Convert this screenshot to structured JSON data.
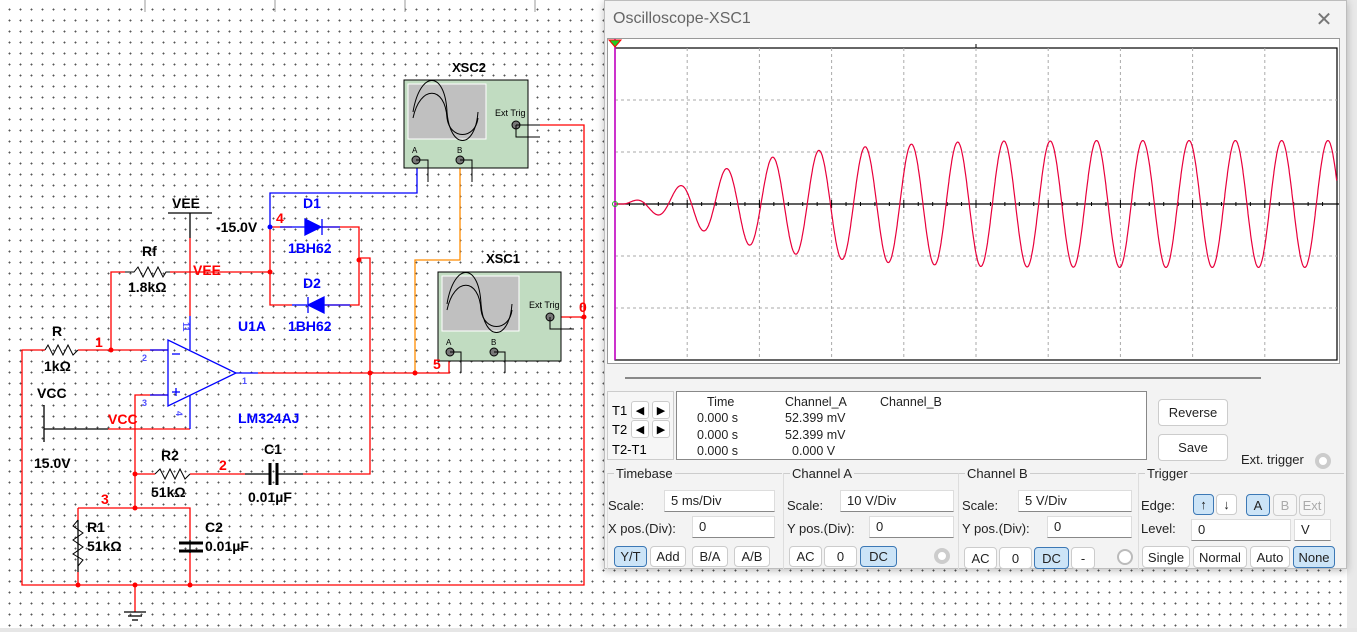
{
  "schematic": {
    "components": {
      "R": {
        "name": "R",
        "value": "1kΩ"
      },
      "Rf": {
        "name": "Rf",
        "value": "1.8kΩ"
      },
      "R1": {
        "name": "R1",
        "value": "51kΩ"
      },
      "R2": {
        "name": "R2",
        "value": "51kΩ"
      },
      "C1": {
        "name": "C1",
        "value": "0.01µF"
      },
      "C2": {
        "name": "C2",
        "value": "0.01µF"
      },
      "D1": {
        "name": "D1",
        "value": "1BH62"
      },
      "D2": {
        "name": "D2",
        "value": "1BH62"
      },
      "U1A": {
        "name": "U1A",
        "part": "LM324AJ",
        "pins": {
          "inv": "2",
          "noninv": "3",
          "out": "1",
          "vee": "11",
          "vcc": "4"
        }
      },
      "VEE": {
        "name": "VEE",
        "value": "-15.0V"
      },
      "VCC": {
        "name": "VCC",
        "value": "15.0V"
      },
      "XSC1": {
        "name": "XSC1",
        "ext_trig": "Ext Trig",
        "a": "A",
        "b": "B"
      },
      "XSC2": {
        "name": "XSC2",
        "ext_trig": "Ext Trig",
        "a": "A",
        "b": "B"
      }
    },
    "net_labels": {
      "vee": "VEE",
      "vcc": "VCC"
    },
    "nodes": {
      "n0": "0",
      "n1": "1",
      "n2": "2",
      "n3": "3",
      "n4": "4",
      "n5": "5"
    },
    "colors": {
      "wire": "#ff0000",
      "component": "#0000ff",
      "wire_b": "#ff8c00",
      "label": "#000000"
    }
  },
  "oscilloscope": {
    "title": "Oscilloscope-XSC1",
    "close_icon": "close-icon",
    "cursors": {
      "t1": "T1",
      "t2": "T2",
      "diff": "T2-T1"
    },
    "readout": {
      "headers": [
        "Time",
        "Channel_A",
        "Channel_B"
      ],
      "rows": [
        {
          "time": "0.000 s",
          "a": "52.399 mV",
          "b": ""
        },
        {
          "time": "0.000 s",
          "a": "52.399 mV",
          "b": ""
        },
        {
          "time": "0.000 s",
          "a": "0.000 V",
          "b": ""
        }
      ]
    },
    "reverse_label": "Reverse",
    "save_label": "Save",
    "ext_trigger_label": "Ext. trigger",
    "timebase": {
      "title": "Timebase",
      "scale_label": "Scale:",
      "scale": "5 ms/Div",
      "xpos_label": "X pos.(Div):",
      "xpos": "0",
      "modes": [
        "Y/T",
        "Add",
        "B/A",
        "A/B"
      ],
      "selected_mode": "Y/T"
    },
    "channel_a": {
      "title": "Channel A",
      "scale_label": "Scale:",
      "scale": "10  V/Div",
      "ypos_label": "Y pos.(Div):",
      "ypos": "0",
      "coupling": [
        "AC",
        "0",
        "DC"
      ],
      "selected": "DC"
    },
    "channel_b": {
      "title": "Channel B",
      "scale_label": "Scale:",
      "scale": "5  V/Div",
      "ypos_label": "Y pos.(Div):",
      "ypos": "0",
      "coupling": [
        "AC",
        "0",
        "DC",
        "-"
      ],
      "selected": "DC"
    },
    "trigger": {
      "title": "Trigger",
      "edge_label": "Edge:",
      "edge_rising": "↑",
      "edge_falling": "↓",
      "sources": [
        "A",
        "B",
        "Ext"
      ],
      "selected_source": "A",
      "level_label": "Level:",
      "level": "0",
      "level_unit": "V",
      "modes": [
        "Single",
        "Normal",
        "Auto",
        "None"
      ],
      "selected_mode": "None"
    }
  },
  "chart_data": {
    "type": "line",
    "title": "",
    "xlabel": "",
    "ylabel": "",
    "x_unit": "ms",
    "y_unit": "V",
    "xlim": [
      0,
      50
    ],
    "ylim": [
      -30,
      30
    ],
    "divisions": {
      "x": 10,
      "y": 6
    },
    "grid": true,
    "series": [
      {
        "color": "#e8003c",
        "frequency_hz": 312,
        "first_peak_ms": 4.5,
        "peak_amplitudes_v": [
          3.5,
          6.8,
          9.0,
          10.3,
          11.0,
          11.5,
          11.9,
          12.1,
          12.1,
          12.2,
          12.2,
          12.2,
          12.2,
          12.2,
          12.2
        ]
      }
    ],
    "cursor_color": "#cc00cc"
  }
}
